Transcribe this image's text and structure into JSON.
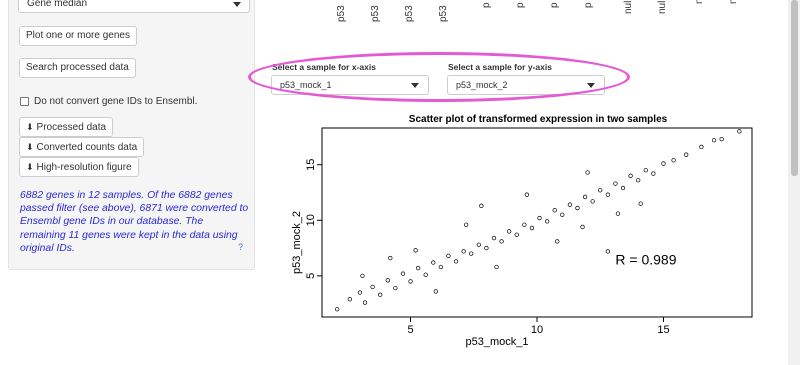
{
  "sidebar": {
    "select_value": "Gene median",
    "plot_genes_button": "Plot one or more genes",
    "search_button": "Search processed data",
    "checkbox_label": "Do not convert gene IDs to Ensembl.",
    "download_processed": "Processed data",
    "download_counts": "Converted counts data",
    "download_figure": "High-resolution figure",
    "info_text": "6882 genes in 12 samples. Of the 6882 genes passed filter (see above), 6871 were converted to Ensembl gene IDs in our database. The remaining 11 genes were kept in the data using original IDs.",
    "help_mark": "?"
  },
  "column_labels": [
    "p53",
    "p53",
    "p53",
    "p53",
    "p",
    "p",
    "p",
    "p",
    "null",
    "null",
    "n",
    "n"
  ],
  "selectors": {
    "x_label": "Select a sample for x-axis",
    "x_value": "p53_mock_1",
    "y_label": "Select a sample for y-axis",
    "y_value": "p53_mock_2"
  },
  "highlight_color": "#e35ad4",
  "chart_data": {
    "type": "scatter",
    "title": "Scatter plot of transformed expression in two samples",
    "xlabel": "p53_mock_1",
    "ylabel": "p53_mock_2",
    "xlim": [
      1.5,
      18.5
    ],
    "ylim": [
      1.3,
      18.3
    ],
    "xticks": [
      5,
      10,
      15
    ],
    "yticks": [
      5,
      10,
      15
    ],
    "annotation": "R = 0.989",
    "grid": false,
    "points": [
      [
        2.1,
        2.0
      ],
      [
        2.6,
        2.9
      ],
      [
        3.0,
        3.5
      ],
      [
        3.2,
        2.6
      ],
      [
        3.5,
        4.0
      ],
      [
        3.8,
        3.3
      ],
      [
        4.1,
        4.6
      ],
      [
        4.4,
        3.9
      ],
      [
        4.7,
        5.2
      ],
      [
        5.0,
        4.5
      ],
      [
        5.3,
        5.7
      ],
      [
        5.6,
        5.1
      ],
      [
        5.9,
        6.2
      ],
      [
        6.2,
        5.8
      ],
      [
        6.5,
        6.8
      ],
      [
        6.8,
        6.3
      ],
      [
        7.1,
        7.2
      ],
      [
        7.4,
        7.0
      ],
      [
        7.7,
        7.8
      ],
      [
        8.0,
        7.5
      ],
      [
        8.3,
        8.4
      ],
      [
        8.6,
        8.1
      ],
      [
        8.9,
        9.0
      ],
      [
        9.2,
        8.7
      ],
      [
        9.5,
        9.6
      ],
      [
        9.8,
        9.3
      ],
      [
        10.1,
        10.2
      ],
      [
        10.4,
        9.9
      ],
      [
        10.7,
        10.9
      ],
      [
        11.0,
        10.5
      ],
      [
        11.3,
        11.4
      ],
      [
        11.6,
        11.1
      ],
      [
        11.9,
        12.1
      ],
      [
        12.2,
        11.7
      ],
      [
        12.5,
        12.7
      ],
      [
        12.8,
        12.3
      ],
      [
        13.1,
        13.3
      ],
      [
        13.4,
        12.9
      ],
      [
        13.7,
        14.0
      ],
      [
        14.0,
        13.6
      ],
      [
        14.3,
        14.5
      ],
      [
        14.6,
        14.2
      ],
      [
        15.0,
        15.1
      ],
      [
        15.4,
        15.4
      ],
      [
        15.9,
        15.9
      ],
      [
        16.5,
        16.6
      ],
      [
        17.0,
        17.2
      ],
      [
        17.3,
        17.3
      ],
      [
        18.0,
        18.0
      ],
      [
        5.2,
        7.3
      ],
      [
        6.0,
        3.6
      ],
      [
        7.2,
        9.6
      ],
      [
        8.4,
        5.8
      ],
      [
        9.6,
        12.3
      ],
      [
        10.8,
        8.1
      ],
      [
        12.0,
        14.3
      ],
      [
        13.2,
        10.6
      ],
      [
        14.1,
        11.5
      ],
      [
        4.2,
        6.6
      ],
      [
        3.1,
        5.0
      ],
      [
        11.8,
        9.4
      ],
      [
        12.8,
        7.2
      ],
      [
        7.8,
        11.3
      ]
    ]
  }
}
